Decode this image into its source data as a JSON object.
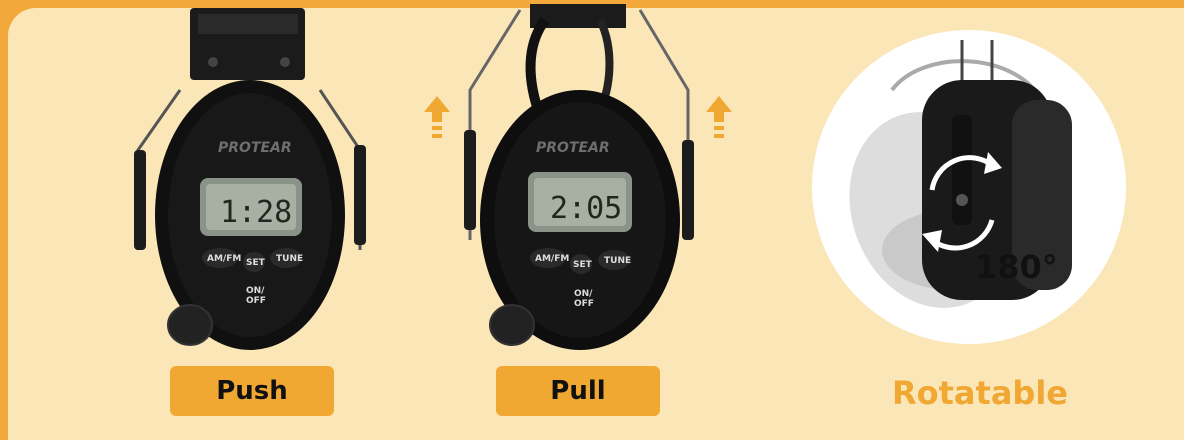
{
  "labels": {
    "push": "Push",
    "pull": "Pull",
    "rotatable": "Rotatable"
  },
  "earmuff_left": {
    "brand": "PROTEAR",
    "display_time": "1:28",
    "buttons": {
      "am_fm": "AM/FM",
      "set": "SET",
      "tune": "TUNE"
    },
    "power": {
      "line1": "ON/",
      "line2": "OFF"
    }
  },
  "earmuff_right": {
    "brand": "PROTEAR",
    "display_time": "2:05",
    "buttons": {
      "am_fm": "AM/FM",
      "set": "SET",
      "tune": "TUNE"
    },
    "power": {
      "line1": "ON/",
      "line2": "OFF"
    }
  },
  "rotation": {
    "degrees_label": "180°"
  },
  "icons": [
    "up-arrow-icon",
    "up-arrow-icon",
    "rotate-arrows-icon"
  ],
  "colors": {
    "frame_orange": "#f2a83a",
    "panel_cream": "#fbe6b8",
    "accent": "#f0a832",
    "earmuff_black": "#111111"
  }
}
